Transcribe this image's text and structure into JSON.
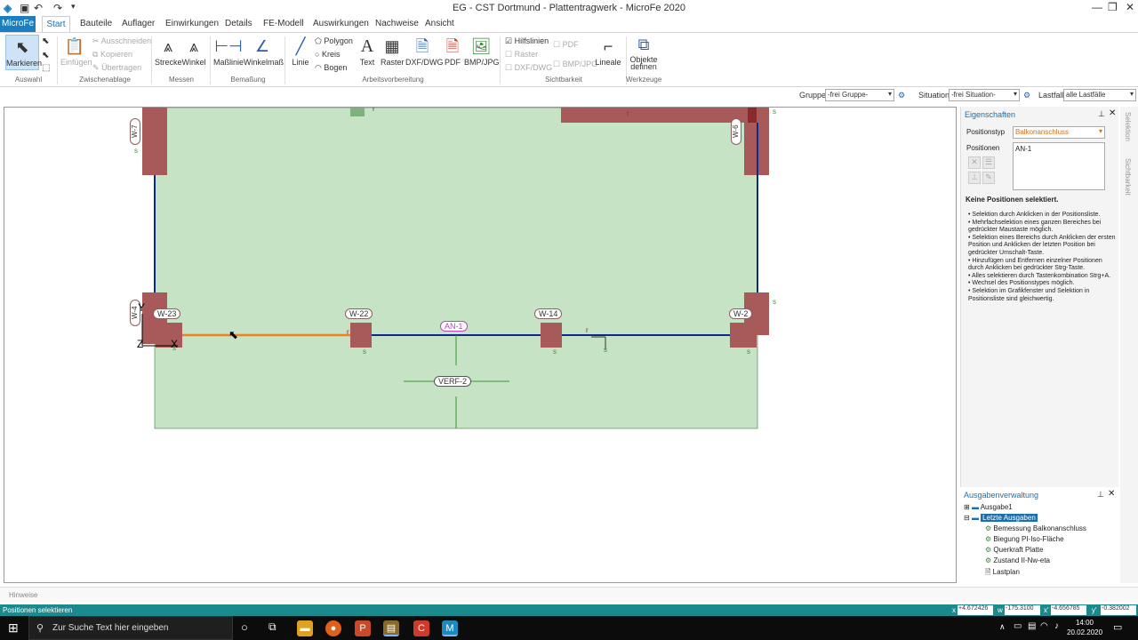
{
  "window": {
    "title": "EG - CST Dortmund - Plattentragwerk - MicroFe 2020",
    "minimize": "—",
    "restore": "❐",
    "close": "✕"
  },
  "menu": {
    "file": "MicroFe",
    "items": [
      "Start",
      "Bauteile",
      "Auflager",
      "Einwirkungen",
      "Details",
      "FE-Modell",
      "Auswirkungen",
      "Nachweise",
      "Ansicht"
    ]
  },
  "ribbon": {
    "markieren": "Markieren",
    "einfuegen": "Einfügen",
    "ausschneiden": "Ausschneiden",
    "kopieren": "Kopieren",
    "uebertragen": "Übertragen",
    "strecke": "Strecke",
    "winkel": "Winkel",
    "masslinie": "Maßlinie",
    "winkelmass": "Winkelmaß",
    "linie": "Linie",
    "polygon": "Polygon",
    "kreis": "Kreis",
    "bogen": "Bogen",
    "text": "Text",
    "raster": "Raster",
    "dxf": "DXF/DWG",
    "pdf": "PDF",
    "bmp": "BMP/JPG",
    "hilfslinien": "Hilfslinien",
    "raster_s": "Raster",
    "dxf_s": "DXF/DWG",
    "pdf_s": "PDF",
    "bmp_s": "BMP/JPG",
    "lineale": "Lineale",
    "objekte_1": "Objekte",
    "objekte_2": "definen",
    "groups": {
      "auswahl": "Auswahl",
      "zwischenablage": "Zwischenablage",
      "messen": "Messen",
      "bemassung": "Bemaßung",
      "arbeitsvorbereitung": "Arbeitsvorbereitung",
      "sichtbarkeit": "Sichtbarkeit",
      "werkzeuge": "Werkzeuge"
    }
  },
  "filter": {
    "gruppe_label": "Gruppe",
    "gruppe_value": "-frei Gruppe-",
    "situation_label": "Situation",
    "situation_value": "-frei Situation-",
    "lastfall_label": "Lastfall",
    "lastfall_value": "alle Lastfälle"
  },
  "canvas": {
    "labels": {
      "w7": "W-7",
      "w6": "W-6",
      "w4": "W-4",
      "w23": "W-23",
      "w22": "W-22",
      "w14": "W-14",
      "w2": "W-2",
      "an1": "AN-1",
      "verf2": "VERF-2",
      "s": "s",
      "r": "r",
      "axis_y": "Y",
      "axis_z": "Z",
      "axis_x": "X"
    },
    "colors": {
      "plate": "#c7e3c6",
      "wall": "#a85a5a",
      "edge": "#0b2a8a",
      "selected": "#f08020",
      "grid": "#2e9a2e"
    }
  },
  "properties": {
    "title": "Eigenschaften",
    "positionstyp_label": "Positionstyp",
    "positionstyp_value": "Balkonanschluss",
    "positionen_label": "Positionen",
    "positionen_value": "AN-1",
    "none_selected": "Keine Positionen selektiert.",
    "hints": [
      "Selektion durch Anklicken in der Positionsliste.",
      "Mehrfachselektion eines ganzen Bereiches bei gedrückter Maustaste möglich.",
      "Selektion eines Bereichs durch Anklicken der ersten Position und Anklicken der letzten Position bei gedrückter Umschalt-Taste.",
      "Hinzufügen und Entfernen einzelner Positionen durch Anklicken bei gedrückter Strg-Taste.",
      "Alles selektieren durch Tastenkombination Strg+A.",
      "Wechsel des Positionstypes möglich.",
      "Selektion im Grafikfenster und Selektion in Positionsliste sind gleichwertig."
    ]
  },
  "output": {
    "title": "Ausgabenverwaltung",
    "root1": "Ausgabe1",
    "root2": "Letzte Ausgaben",
    "children": [
      "Bemessung Balkonanschluss",
      "Biegung PI-Iso-Fläche",
      "Querkraft Platte",
      "Zustand II-Nw-eta",
      "Lastplan"
    ]
  },
  "sidetabs": {
    "selektion": "Selektion",
    "sichtbarkeit": "Sichtbarkeit"
  },
  "hinweise": "Hinweise",
  "status": {
    "message": "Positionen selektieren",
    "x_label": "x",
    "x_value": "+4.672426",
    "w_label": "w",
    "w_value": "-175.3100",
    "x2_label": "x'",
    "x2_value": "-4.656785",
    "y_label": "y'",
    "y_value": "-0.382002"
  },
  "taskbar": {
    "search_placeholder": "Zur Suche Text hier eingeben",
    "time": "14:00",
    "date": "20.02.2020"
  }
}
